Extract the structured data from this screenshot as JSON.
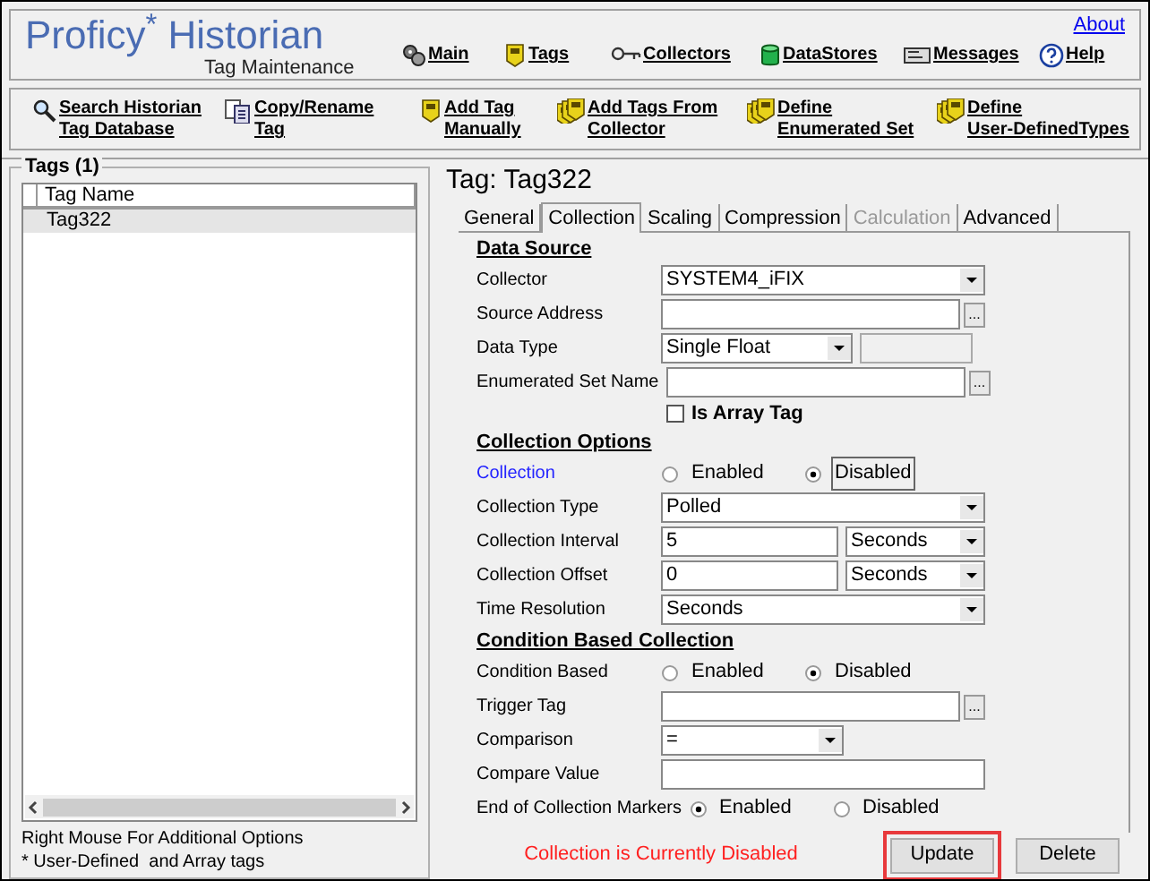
{
  "header": {
    "title": "Proficy$^{*}$ Historian",
    "subtitle": "Tag Maintenance",
    "about_link": "About"
  },
  "nav": [
    {
      "label": "Main"
    },
    {
      "label": "Tags"
    },
    {
      "label": "Collectors"
    },
    {
      "label": "DataStores"
    },
    {
      "label": "Messages"
    },
    {
      "label": "Help"
    }
  ],
  "toolbar": [
    {
      "lines": [
        "Search Historian",
        "Tag Database"
      ]
    },
    {
      "lines": [
        "Copy/Rename",
        "Tag"
      ]
    },
    {
      "lines": [
        "Add Tag",
        "Manually"
      ]
    },
    {
      "lines": [
        "Add Tags From",
        "Collector"
      ]
    },
    {
      "lines": [
        "Define",
        "Enumerated Set"
      ]
    },
    {
      "lines": [
        "Define",
        "User-DefinedTypes"
      ]
    }
  ],
  "tags_panel": {
    "title": "Tags (1)",
    "column": "Tag Name",
    "rows": [
      {
        "name": "Tag322",
        "selected": true
      }
    ],
    "hint": "Right Mouse For Additional Options",
    "legend": "* User-Defined  and Array tags"
  },
  "detail": {
    "title": "Tag: Tag322",
    "tabs": [
      {
        "label": "General",
        "selected": false,
        "disabled": false
      },
      {
        "label": "Collection",
        "selected": true,
        "disabled": false
      },
      {
        "label": "Scaling",
        "selected": false,
        "disabled": false
      },
      {
        "label": "Compression",
        "selected": false,
        "disabled": false
      },
      {
        "label": "Calculation",
        "selected": false,
        "disabled": true
      },
      {
        "label": "Advanced",
        "selected": false,
        "disabled": false
      }
    ],
    "sections": [
      {
        "heading": "Data Source",
        "rows": [
          {
            "kind": "select",
            "label": "Collector",
            "value": "SYSTEM4_iFIX"
          },
          {
            "kind": "input_browse",
            "label": "Source Address",
            "browse": "..."
          },
          {
            "kind": "select_with_box",
            "label": "Data Type",
            "value": "Single Float"
          },
          {
            "kind": "input_browse",
            "label": "Enumerated Set Name",
            "browse": "..."
          },
          {
            "kind": "checkbox",
            "label": "Is Array Tag",
            "checked": false
          }
        ]
      },
      {
        "heading": "Collection Options",
        "rows": [
          {
            "kind": "radio",
            "label": "Collection",
            "link": true,
            "options": [
              {
                "label": "Enabled",
                "selected": false,
                "focused": false
              },
              {
                "label": "Disabled",
                "selected": true,
                "focused": true
              }
            ]
          },
          {
            "kind": "select",
            "label": "Collection Type",
            "value": "Polled"
          },
          {
            "kind": "input_select",
            "label": "Collection Interval",
            "value": "5",
            "unit": "Seconds"
          },
          {
            "kind": "input_select",
            "label": "Collection Offset",
            "value": "0",
            "unit": "Seconds"
          },
          {
            "kind": "select",
            "label": "Time Resolution",
            "value": "Seconds"
          }
        ]
      },
      {
        "heading": "Condition Based Collection",
        "rows": [
          {
            "kind": "radio",
            "label": "Condition Based",
            "link": false,
            "options": [
              {
                "label": "Enabled",
                "selected": false,
                "focused": false
              },
              {
                "label": "Disabled",
                "selected": true,
                "focused": false
              }
            ]
          },
          {
            "kind": "input_browse",
            "label": "Trigger Tag",
            "browse": "..."
          },
          {
            "kind": "select_short",
            "label": "Comparison",
            "value": "="
          },
          {
            "kind": "input",
            "label": "Compare Value"
          },
          {
            "kind": "radio",
            "label": "End of Collection Markers",
            "link": false,
            "options": [
              {
                "label": "Enabled",
                "selected": true,
                "focused": false
              },
              {
                "label": "Disabled",
                "selected": false,
                "focused": false
              }
            ]
          }
        ]
      }
    ]
  },
  "footer": {
    "status": "Collection is Currently Disabled",
    "buttons": [
      {
        "label": "Update",
        "highlighted": true
      },
      {
        "label": "Delete",
        "highlighted": false
      }
    ]
  }
}
